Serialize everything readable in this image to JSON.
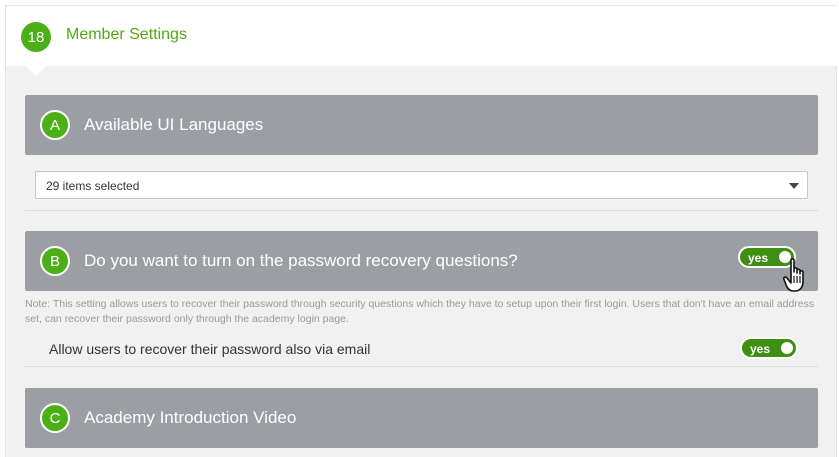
{
  "step": {
    "number": "18",
    "title": "Member Settings"
  },
  "sections": {
    "a": {
      "letter": "A",
      "title": "Available UI Languages"
    },
    "b": {
      "letter": "B",
      "title": "Do you want to turn on the password recovery questions?"
    },
    "c": {
      "letter": "C",
      "title": "Academy Introduction Video"
    }
  },
  "languages_select": {
    "value": "29 items selected"
  },
  "recovery_toggle": {
    "label": "yes",
    "state": true
  },
  "note": "Note: This setting allows users to recover their password through security questions which they have to setup upon their first login. Users that don't have an email address set, can recover their password only through the academy login page.",
  "email_recovery": {
    "label": "Allow users to recover their password also via email",
    "toggle_label": "yes",
    "state": true
  },
  "colors": {
    "accent_green": "#4caf16",
    "toggle_green": "#3f8f12",
    "header_gray": "#9b9fa3"
  },
  "icons": [
    "hand-pointer-icon",
    "chevron-down-icon"
  ]
}
